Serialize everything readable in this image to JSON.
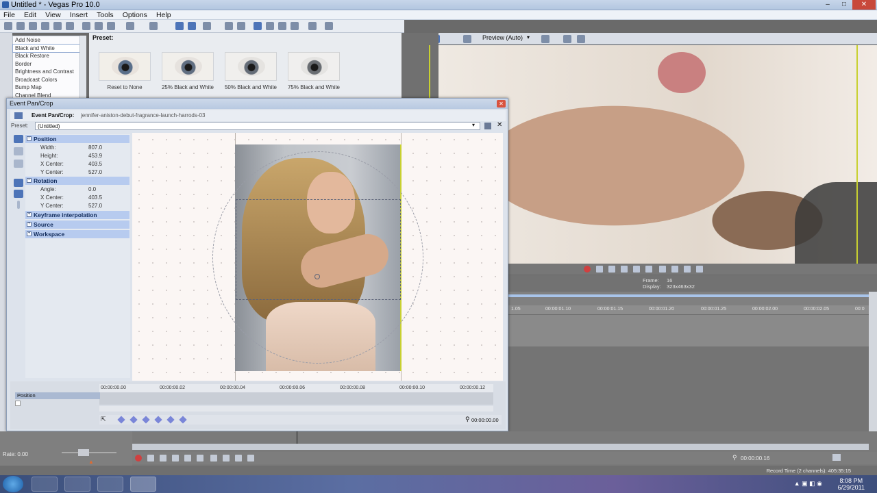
{
  "app": {
    "title": "Untitled * - Vegas Pro 10.0"
  },
  "menu": [
    "File",
    "Edit",
    "View",
    "Insert",
    "Tools",
    "Options",
    "Help"
  ],
  "fx": {
    "items": [
      "Add Noise",
      "Black and White",
      "Black Restore",
      "Border",
      "Brightness and Contrast",
      "Broadcast Colors",
      "Bump Map",
      "Channel Blend"
    ],
    "selected_index": 1,
    "preset_label": "Preset:",
    "presets": [
      "Reset to None",
      "25% Black and White",
      "50% Black and White",
      "75% Black and White"
    ]
  },
  "preview": {
    "mode": "Preview (Auto)",
    "frame_label": "Frame:",
    "frame_value": "16",
    "display_label": "Display:",
    "display_value": "323x463x32"
  },
  "timeline": {
    "ticks": [
      "1.05",
      "00:00:01.10",
      "00:00:01.15",
      "00:00:01.20",
      "00:00:01.25",
      "00:00:02.00",
      "00:00:02.05",
      "00:0"
    ]
  },
  "epc": {
    "title": "Event Pan/Crop",
    "header_label": "Event Pan/Crop:",
    "header_value": "jennifer-aniston-debut-fragrance-launch-harrods-03",
    "preset_label": "Preset:",
    "preset_value": "(Untitled)",
    "sections": {
      "position": "Position",
      "rotation": "Rotation",
      "keyframe": "Keyframe interpolation",
      "source": "Source",
      "workspace": "Workspace"
    },
    "position_rows": [
      {
        "k": "Width:",
        "v": "807.0"
      },
      {
        "k": "Height:",
        "v": "453.9"
      },
      {
        "k": "X Center:",
        "v": "403.5"
      },
      {
        "k": "Y Center:",
        "v": "527.0"
      }
    ],
    "rotation_rows": [
      {
        "k": "Angle:",
        "v": "0.0"
      },
      {
        "k": "X Center:",
        "v": "403.5"
      },
      {
        "k": "Y Center:",
        "v": "527.0"
      }
    ],
    "ruler": [
      "00:00:00.00",
      "00:00:00.02",
      "00:00:00.04",
      "00:00:00.06",
      "00:00:00.08",
      "00:00:00.10",
      "00:00:00.12"
    ],
    "track_label": "Position",
    "time_display": "00:00:00.00"
  },
  "bottom": {
    "rate": "Rate: 0.00",
    "time": "00:00:00.16",
    "record_time": "Record Time (2 channels): 405:35:15"
  },
  "taskbar": {
    "time": "8:08 PM",
    "date": "6/29/2011"
  }
}
